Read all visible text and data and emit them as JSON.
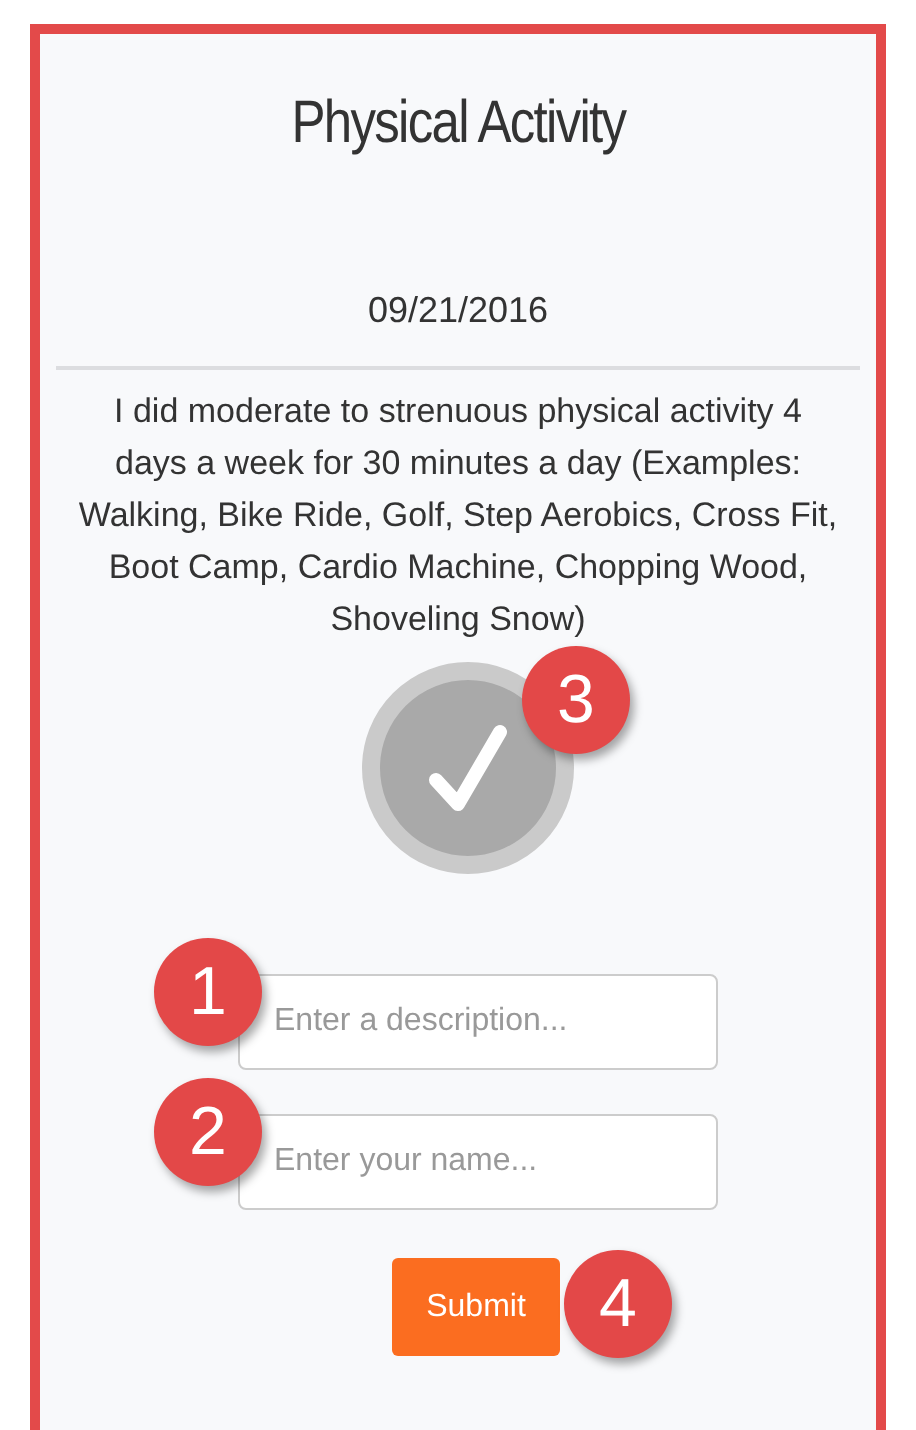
{
  "title": "Physical Activity",
  "date": "09/21/2016",
  "description": "I did moderate to strenuous physical activity 4 days a week for 30 minutes a day (Examples: Walking, Bike Ride, Golf, Step Aerobics, Cross Fit, Boot Camp, Cardio Machine, Chopping Wood, Shoveling Snow)",
  "check_callout": "3",
  "fields": [
    {
      "placeholder": "Enter a description...",
      "callout": "1"
    },
    {
      "placeholder": "Enter your name...",
      "callout": "2"
    }
  ],
  "submit": {
    "label": "Submit",
    "callout": "4"
  }
}
